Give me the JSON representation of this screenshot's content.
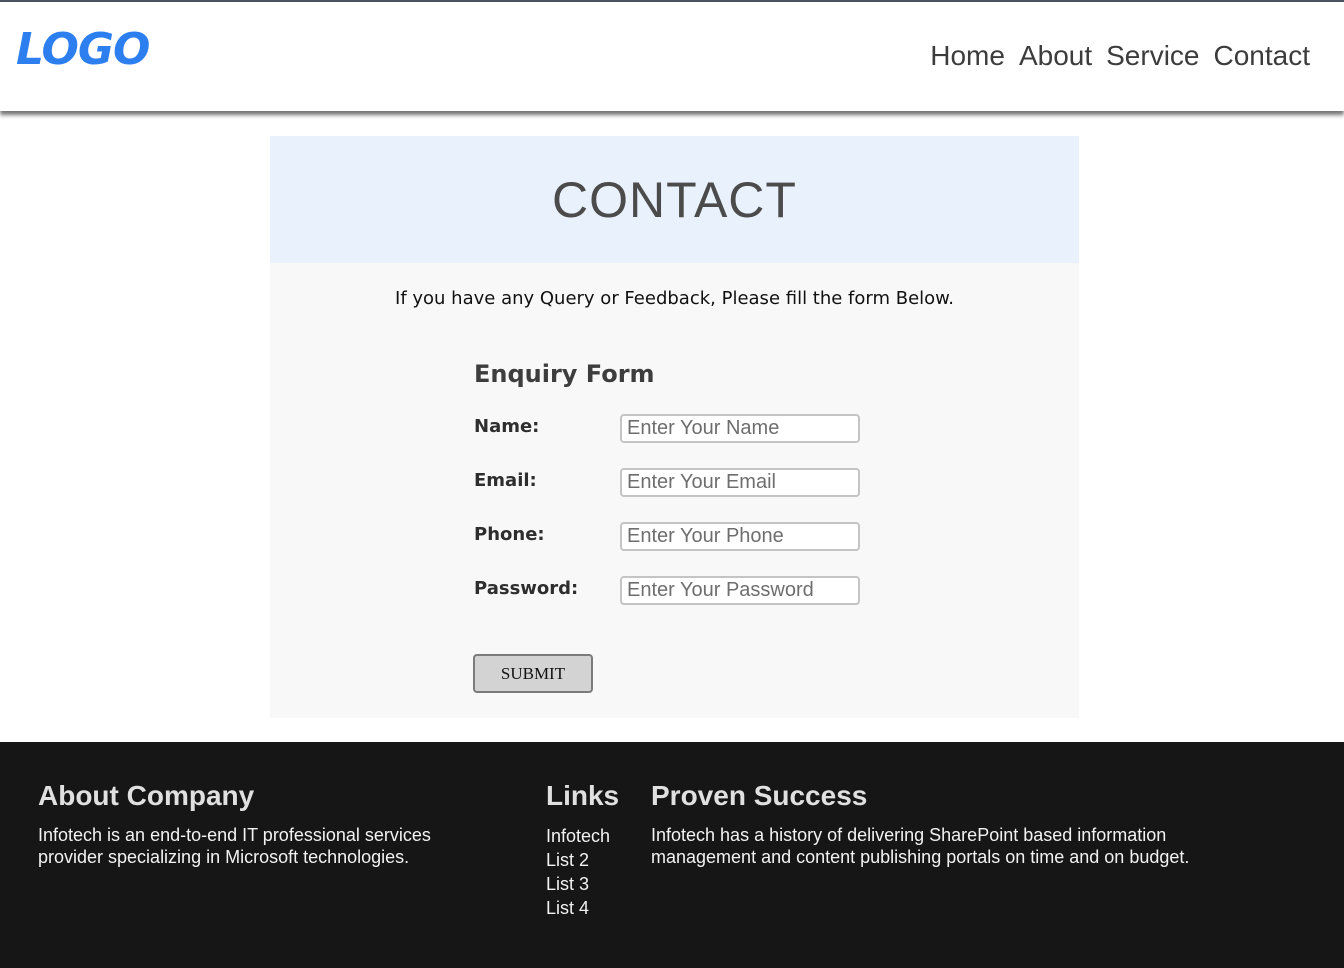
{
  "header": {
    "logo": "LOGO",
    "nav": [
      "Home",
      "About",
      "Service",
      "Contact"
    ]
  },
  "contact": {
    "title": "CONTACT",
    "intro": "If you have any Query or Feedback, Please fill the form Below.",
    "form_title": "Enquiry Form",
    "fields": [
      {
        "label": "Name:",
        "placeholder": "Enter Your Name"
      },
      {
        "label": "Email:",
        "placeholder": "Enter Your Email"
      },
      {
        "label": "Phone:",
        "placeholder": "Enter Your Phone"
      },
      {
        "label": "Password:",
        "placeholder": "Enter Your Password"
      }
    ],
    "submit_label": "SUBMIT"
  },
  "footer": {
    "about": {
      "title": "About Company",
      "text": "Infotech is an end-to-end IT professional services provider specializing in Microsoft technologies."
    },
    "links": {
      "title": "Links",
      "items": [
        "Infotech",
        "List 2",
        "List 3",
        "List 4"
      ]
    },
    "success": {
      "title": "Proven Success",
      "text": "Infotech has a history of delivering SharePoint based information management and content publishing portals on time and on budget."
    }
  },
  "colors": {
    "logo": "#2d7ff0",
    "card_header_bg": "#e9f1fd",
    "footer_bg": "#161616"
  }
}
